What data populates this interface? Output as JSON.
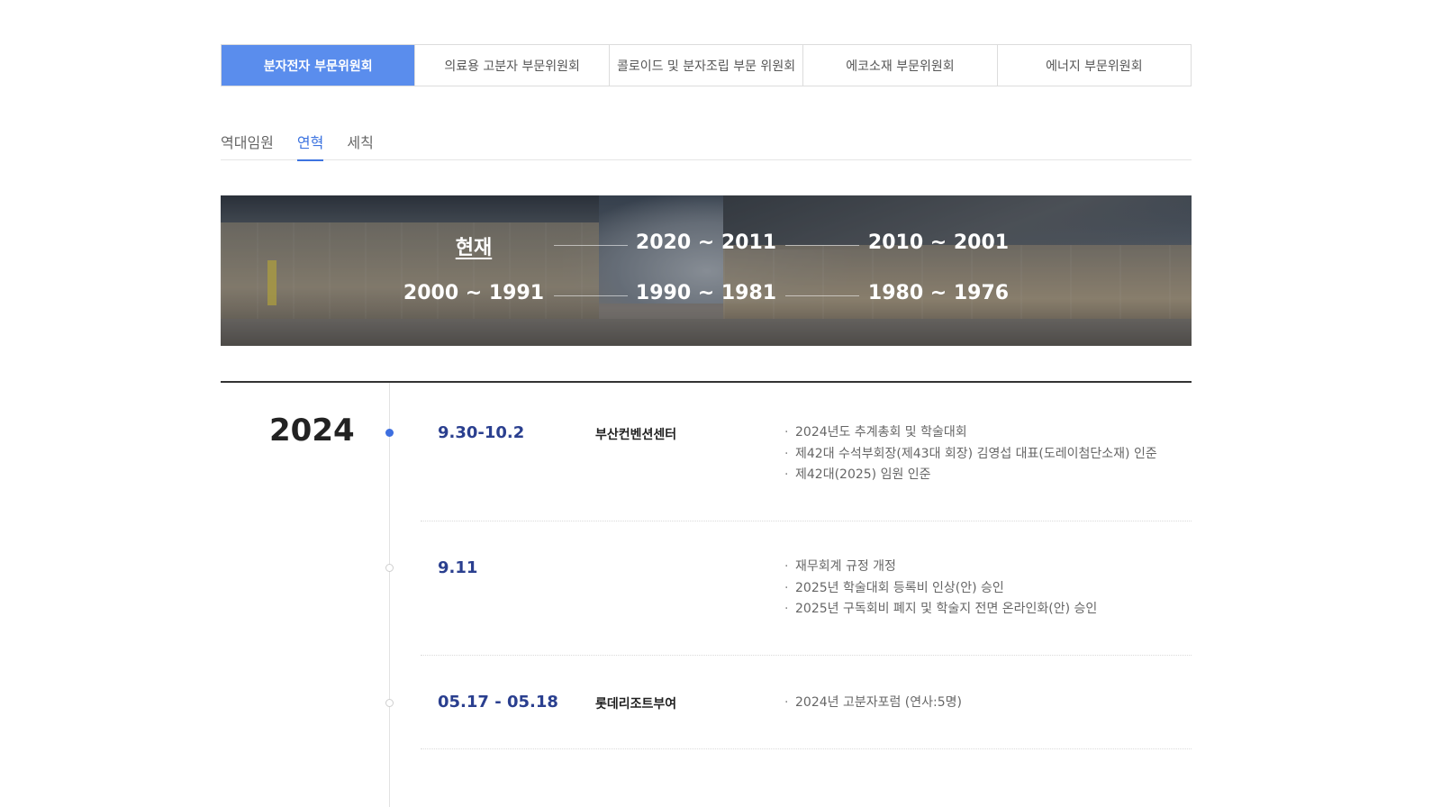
{
  "committee_tabs": [
    {
      "label": "분자전자 부문위원회",
      "active": true
    },
    {
      "label": "의료용 고분자 부문위원회",
      "active": false
    },
    {
      "label": "콜로이드 및  분자조립 부문 위원회",
      "active": false
    },
    {
      "label": "에코소재 부문위원회",
      "active": false
    },
    {
      "label": "에너지 부문위원회",
      "active": false
    }
  ],
  "sub_tabs": [
    {
      "label": "역대임원",
      "active": false
    },
    {
      "label": "연혁",
      "active": true
    },
    {
      "label": "세칙",
      "active": false
    }
  ],
  "banner": {
    "periods": [
      "현재",
      "2020 ~ 2011",
      "2010 ~ 2001",
      "2000 ~ 1991",
      "1990 ~ 1981",
      "1980 ~ 1976"
    ],
    "current_index": 0
  },
  "timeline": {
    "year": "2024",
    "entries": [
      {
        "date": "9.30-10.2",
        "place": "부산컨벤션센터",
        "items": [
          "2024년도 추계총회 및 학술대회",
          "제42대 수석부회장(제43대 회장) 김영섭 대표(도레이첨단소재) 인준",
          "제42대(2025) 임원 인준"
        ]
      },
      {
        "date": "9.11",
        "place": "",
        "items": [
          "재무회계 규정 개정",
          "2025년 학술대회 등록비 인상(안) 승인",
          "2025년 구독회비 폐지 및 학술지 전면 온라인화(안) 승인"
        ]
      },
      {
        "date": "05.17 - 05.18",
        "place": "롯데리조트부여",
        "items": [
          "2024년 고분자포럼 (연사:5명)"
        ]
      }
    ]
  },
  "colors": {
    "accent": "#5a8ded",
    "subtab_active": "#3d74e0",
    "date_text": "#2a3f8f",
    "dot_active": "#3d6fe0"
  }
}
